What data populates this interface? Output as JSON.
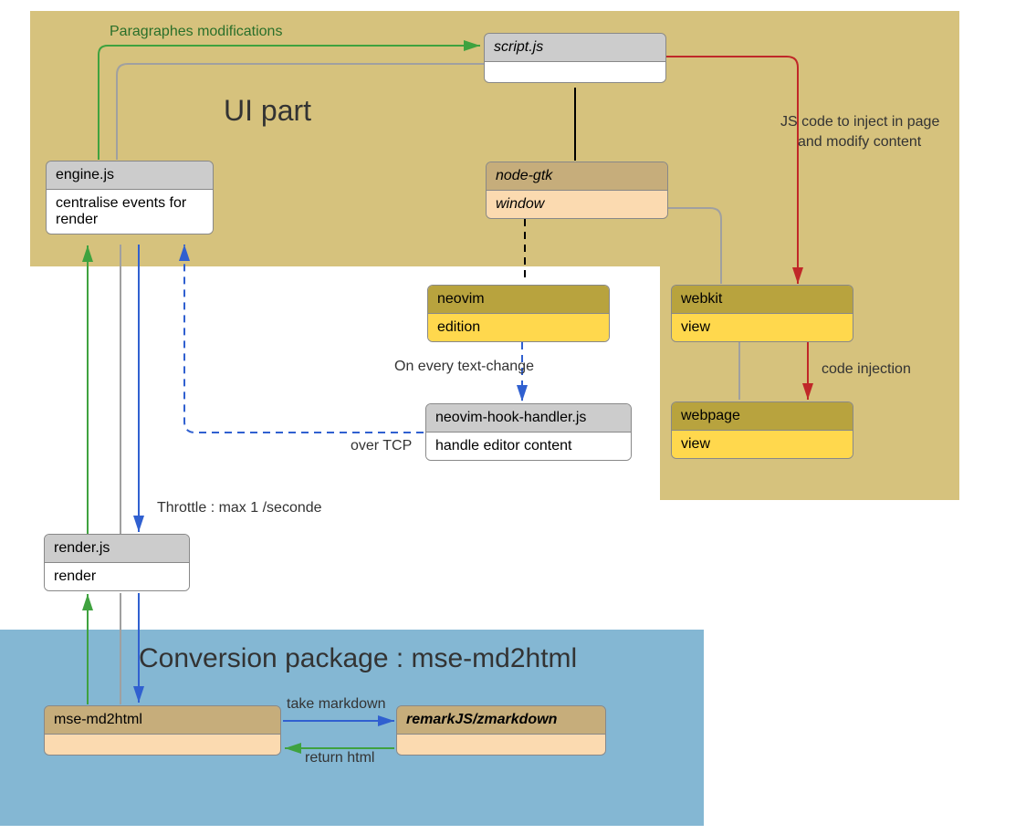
{
  "regions": {
    "ui": {
      "title": "UI part"
    },
    "conv": {
      "title": "Conversion package : mse-md2html"
    }
  },
  "nodes": {
    "script": {
      "title": "script.js",
      "body": ""
    },
    "engine": {
      "title": "engine.js",
      "body": "centralise events for render"
    },
    "nodegtk": {
      "title": "node-gtk",
      "body": "window"
    },
    "neovim": {
      "title": "neovim",
      "body": "edition"
    },
    "nvhook": {
      "title": "neovim-hook-handler.js",
      "body": "handle editor content"
    },
    "webkit": {
      "title": "webkit",
      "body": "view"
    },
    "webpage": {
      "title": "webpage",
      "body": "view"
    },
    "render": {
      "title": "render.js",
      "body": "render"
    },
    "msemd": {
      "title": "mse-md2html",
      "body": ""
    },
    "remark": {
      "title": "remarkJS/zmarkdown",
      "body": ""
    }
  },
  "edges": {
    "engine_to_script": "Paragraphes modifications",
    "script_to_webkit_a": "JS code to inject in page",
    "script_to_webkit_b": "and modify content",
    "nvhook_to_engine": "over TCP",
    "neovim_to_nvhook": "On every text-change",
    "webkit_to_webpage": "code injection",
    "engine_to_render": "Throttle : max 1 /seconde",
    "msemd_to_remark": "take markdown",
    "remark_to_msemd": "return html"
  },
  "colors": {
    "green": "#3fa23f",
    "blue": "#3060d0",
    "red": "#c02828",
    "grey": "#a0a0a0",
    "black": "#000000"
  }
}
